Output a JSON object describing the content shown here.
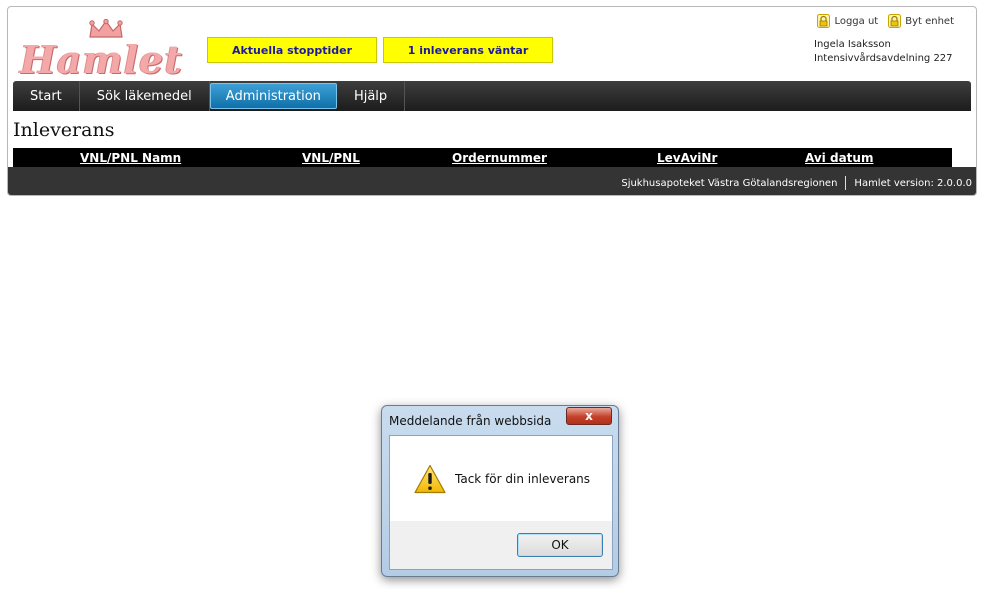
{
  "logo": {
    "text": "Hamlet"
  },
  "header": {
    "stopp_button": "Aktuella stopptider",
    "inleverans_button": "1 inleverans väntar",
    "logout_label": "Logga ut",
    "switch_unit_label": "Byt enhet",
    "user_name": "Ingela Isaksson",
    "user_unit": "Intensivvårdsavdelning 227"
  },
  "nav": {
    "items": [
      {
        "label": "Start",
        "active": false
      },
      {
        "label": "Sök läkemedel",
        "active": false
      },
      {
        "label": "Administration",
        "active": true
      },
      {
        "label": "Hjälp",
        "active": false
      }
    ]
  },
  "main": {
    "title": "Inleverans",
    "columns": [
      "VNL/PNL Namn",
      "VNL/PNL",
      "Ordernummer",
      "LevAviNr",
      "Avi datum"
    ]
  },
  "footer": {
    "organisation": "Sjukhusapoteket Västra Götalandsregionen",
    "version": "Hamlet version: 2.0.0.0"
  },
  "dialog": {
    "title": "Meddelande från webbsida",
    "close_glyph": "x",
    "message": "Tack för din inleverans",
    "ok_label": "OK",
    "icon": "warning-icon"
  },
  "colors": {
    "yellow_button": "#ffff00",
    "nav_active": "#1f86c2",
    "footer": "#343434"
  }
}
